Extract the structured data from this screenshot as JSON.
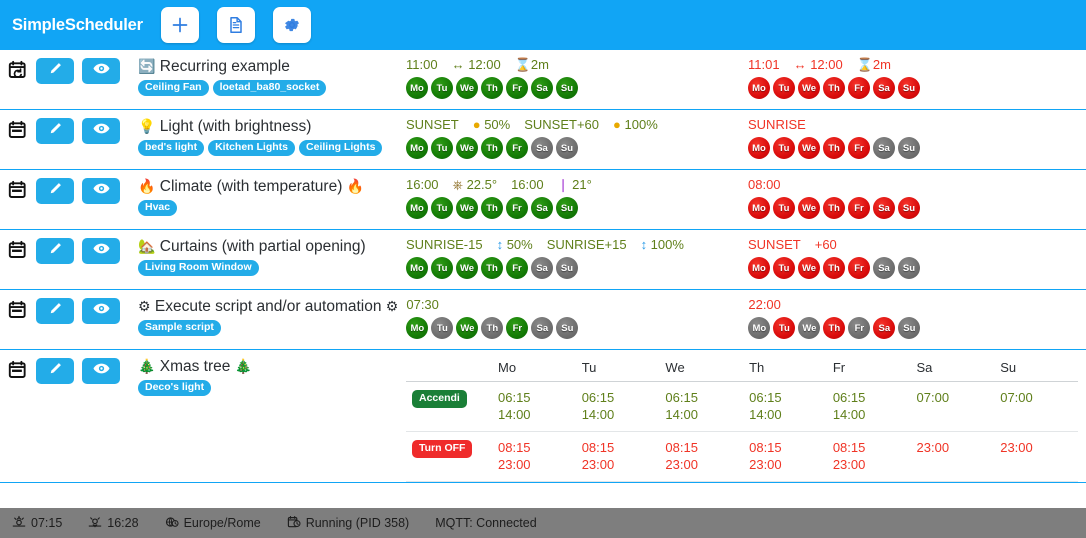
{
  "header": {
    "brand": "SimpleScheduler",
    "buttons": [
      {
        "name": "add-button",
        "icon": "plus-icon"
      },
      {
        "name": "document-button",
        "icon": "document-icon"
      },
      {
        "name": "settings-button",
        "icon": "gear-icon"
      }
    ]
  },
  "colors": {
    "accent": "#11a5f5",
    "button": "#23ace8",
    "on": "#5f7f1a",
    "off": "#f03426",
    "badge_green": "#1a7f37",
    "badge_red": "#ef2b2b",
    "footer": "#7e7e7e"
  },
  "rows": [
    {
      "row_icon": "calendar-recurring-icon",
      "edit_icon": "pencil-icon",
      "view_icon": "eye-icon",
      "title_emoji_left": "🔄",
      "title": "Recurring example",
      "title_emoji_right": "",
      "badges": [
        "Ceiling Fan",
        "loetad_ba80_socket"
      ],
      "on": {
        "tokens": [
          {
            "text": "11:00",
            "icon": ""
          },
          {
            "text": "12:00",
            "icon": "↔"
          },
          {
            "text": "2m",
            "icon": "⧗"
          }
        ],
        "days": [
          "green",
          "green",
          "green",
          "green",
          "green",
          "green",
          "green"
        ]
      },
      "off": {
        "tokens": [
          {
            "text": "11:01",
            "icon": ""
          },
          {
            "text": "12:00",
            "icon": "↔"
          },
          {
            "text": "2m",
            "icon": "⧗"
          }
        ],
        "days": [
          "red",
          "red",
          "red",
          "red",
          "red",
          "red",
          "red"
        ]
      }
    },
    {
      "row_icon": "calendar-icon",
      "edit_icon": "pencil-icon",
      "view_icon": "eye-icon",
      "title_emoji_left": "💡",
      "title": "Light (with brightness)",
      "title_emoji_right": "",
      "badges": [
        "bed's light",
        "Kitchen Lights",
        "Ceiling Lights"
      ],
      "on": {
        "tokens": [
          {
            "text": "SUNSET",
            "icon": ""
          },
          {
            "text": "50%",
            "icon": "💡"
          },
          {
            "text": "SUNSET+60",
            "icon": ""
          },
          {
            "text": "100%",
            "icon": "💡"
          }
        ],
        "days": [
          "green",
          "green",
          "green",
          "green",
          "green",
          "gray",
          "gray"
        ]
      },
      "off": {
        "tokens": [
          {
            "text": "SUNRISE",
            "icon": ""
          }
        ],
        "days": [
          "red",
          "red",
          "red",
          "red",
          "red",
          "gray",
          "gray"
        ]
      }
    },
    {
      "row_icon": "calendar-icon",
      "edit_icon": "pencil-icon",
      "view_icon": "eye-icon",
      "title_emoji_left": "🔥",
      "title": "Climate (with temperature)",
      "title_emoji_right": "🔥",
      "badges": [
        "Hvac"
      ],
      "on": {
        "tokens": [
          {
            "text": "16:00",
            "icon": ""
          },
          {
            "text": "22.5°",
            "icon": "⏻"
          },
          {
            "text": "16:00",
            "icon": ""
          },
          {
            "text": "21°",
            "icon": "🌡"
          }
        ],
        "days": [
          "green",
          "green",
          "green",
          "green",
          "green",
          "green",
          "green"
        ]
      },
      "off": {
        "tokens": [
          {
            "text": "08:00",
            "icon": ""
          }
        ],
        "days": [
          "red",
          "red",
          "red",
          "red",
          "red",
          "red",
          "red"
        ]
      }
    },
    {
      "row_icon": "calendar-icon",
      "edit_icon": "pencil-icon",
      "view_icon": "eye-icon",
      "title_emoji_left": "🏡",
      "title": "Curtains (with partial opening)",
      "title_emoji_right": "",
      "badges": [
        "Living Room Window"
      ],
      "on": {
        "tokens": [
          {
            "text": "SUNRISE-15",
            "icon": ""
          },
          {
            "text": "50%",
            "icon": "↕"
          },
          {
            "text": "SUNRISE+15",
            "icon": ""
          },
          {
            "text": "100%",
            "icon": "↕"
          }
        ],
        "days": [
          "green",
          "green",
          "green",
          "green",
          "green",
          "gray",
          "gray"
        ]
      },
      "off": {
        "tokens": [
          {
            "text": "SUNSET",
            "icon": ""
          },
          {
            "text": "+60",
            "icon": ""
          }
        ],
        "days": [
          "red",
          "red",
          "red",
          "red",
          "red",
          "gray",
          "gray"
        ]
      }
    },
    {
      "row_icon": "calendar-icon",
      "edit_icon": "pencil-icon",
      "view_icon": "eye-icon",
      "title_emoji_left": "⚙",
      "title": "Execute script and/or automation",
      "title_emoji_right": "⚙",
      "badges": [
        "Sample script"
      ],
      "on": {
        "tokens": [
          {
            "text": "07:30",
            "icon": ""
          }
        ],
        "days": [
          "green",
          "gray",
          "green",
          "gray",
          "green",
          "gray",
          "gray"
        ]
      },
      "off": {
        "tokens": [
          {
            "text": "22:00",
            "icon": ""
          }
        ],
        "days": [
          "gray",
          "red",
          "gray",
          "red",
          "gray",
          "red",
          "gray"
        ]
      }
    }
  ],
  "table_row": {
    "row_icon": "calendar-icon",
    "edit_icon": "pencil-icon",
    "view_icon": "eye-icon",
    "title_emoji_left": "🎄",
    "title": "Xmas tree",
    "title_emoji_right": "🎄",
    "badges": [
      "Deco's light"
    ],
    "columns": [
      "",
      "Mo",
      "Tu",
      "We",
      "Th",
      "Fr",
      "Sa",
      "Su"
    ],
    "rows": [
      {
        "label": "Accendi",
        "label_style": "green",
        "cells": [
          [
            "06:15",
            "14:00"
          ],
          [
            "06:15",
            "14:00"
          ],
          [
            "06:15",
            "14:00"
          ],
          [
            "06:15",
            "14:00"
          ],
          [
            "06:15",
            "14:00"
          ],
          [
            "07:00"
          ],
          [
            "07:00"
          ]
        ]
      },
      {
        "label": "Turn OFF",
        "label_style": "red",
        "cells": [
          [
            "08:15",
            "23:00"
          ],
          [
            "08:15",
            "23:00"
          ],
          [
            "08:15",
            "23:00"
          ],
          [
            "08:15",
            "23:00"
          ],
          [
            "08:15",
            "23:00"
          ],
          [
            "23:00"
          ],
          [
            "23:00"
          ]
        ]
      }
    ]
  },
  "footer": {
    "items": [
      {
        "icon": "sunrise-icon",
        "text": "07:15"
      },
      {
        "icon": "sunset-icon",
        "text": "16:28"
      },
      {
        "icon": "globe-clock-icon",
        "text": "Europe/Rome"
      },
      {
        "icon": "running-clock-icon",
        "text": "Running (PID 358)"
      },
      {
        "icon": "",
        "text": "MQTT: Connected"
      }
    ]
  }
}
